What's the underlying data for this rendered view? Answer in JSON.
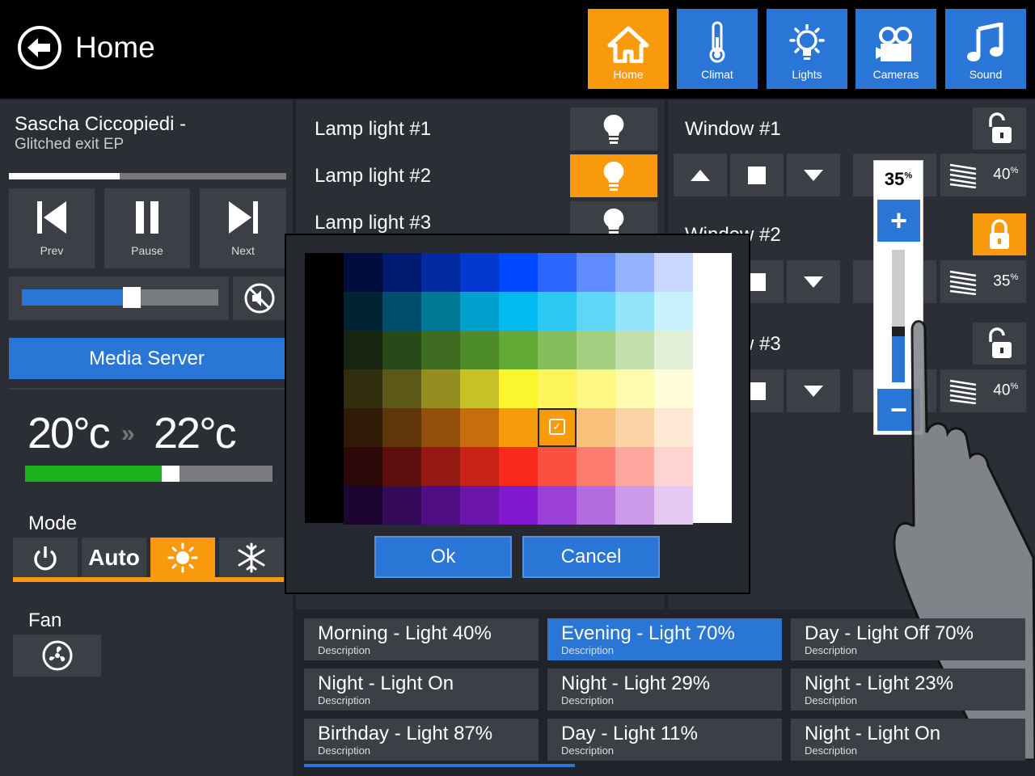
{
  "header": {
    "title": "Home"
  },
  "nav": [
    {
      "label": "Home",
      "icon": "home-icon",
      "active": true
    },
    {
      "label": "Climat",
      "icon": "thermometer-icon",
      "active": false
    },
    {
      "label": "Lights",
      "icon": "lightbulb-icon",
      "active": false
    },
    {
      "label": "Cameras",
      "icon": "camera-icon",
      "active": false
    },
    {
      "label": "Sound",
      "icon": "music-note-icon",
      "active": false
    }
  ],
  "media": {
    "artist": "Sascha Ciccopiedi -",
    "album": "Glitched exit EP",
    "progress": 0.4,
    "volume": 0.55,
    "prev_label": "Prev",
    "pause_label": "Pause",
    "next_label": "Next",
    "server_label": "Media Server"
  },
  "climate": {
    "current": "20°c",
    "target": "22°c",
    "level": 0.58,
    "mode_label": "Mode",
    "auto_label": "Auto",
    "fan_label": "Fan"
  },
  "lamps": [
    {
      "label": "Lamp light #1",
      "on": false
    },
    {
      "label": "Lamp light #2",
      "on": true
    },
    {
      "label": "Lamp light #3",
      "on": false
    }
  ],
  "windows": [
    {
      "label": "Window #1",
      "blind_pct": "40",
      "locked": false
    },
    {
      "label": "Window #2",
      "blind_pct": "35",
      "locked": true
    },
    {
      "label": "Window #3",
      "blind_pct": "40",
      "locked": false
    }
  ],
  "slider_popup": {
    "value": "35",
    "unit": "%",
    "level": 0.35
  },
  "dialog": {
    "ok_label": "Ok",
    "cancel_label": "Cancel",
    "selected": "orange"
  },
  "scenes": [
    {
      "title": "Morning - Light 40%",
      "desc": "Description",
      "selected": false
    },
    {
      "title": "Evening - Light 70%",
      "desc": "Description",
      "selected": true
    },
    {
      "title": "Day - Light Off 70%",
      "desc": "Description",
      "selected": false
    },
    {
      "title": "Night - Light On",
      "desc": "Description",
      "selected": false
    },
    {
      "title": "Night - Light 29%",
      "desc": "Description",
      "selected": false
    },
    {
      "title": "Night - Light 23%",
      "desc": "Description",
      "selected": false
    },
    {
      "title": "Birthday - Light 87%",
      "desc": "Description",
      "selected": false
    },
    {
      "title": "Day - Light 11%",
      "desc": "Description",
      "selected": false
    },
    {
      "title": "Night - Light On",
      "desc": "Description",
      "selected": false
    }
  ],
  "colors": {
    "accent": "#f99a0c",
    "blue": "#2a76d6",
    "bg": "#20232a"
  }
}
